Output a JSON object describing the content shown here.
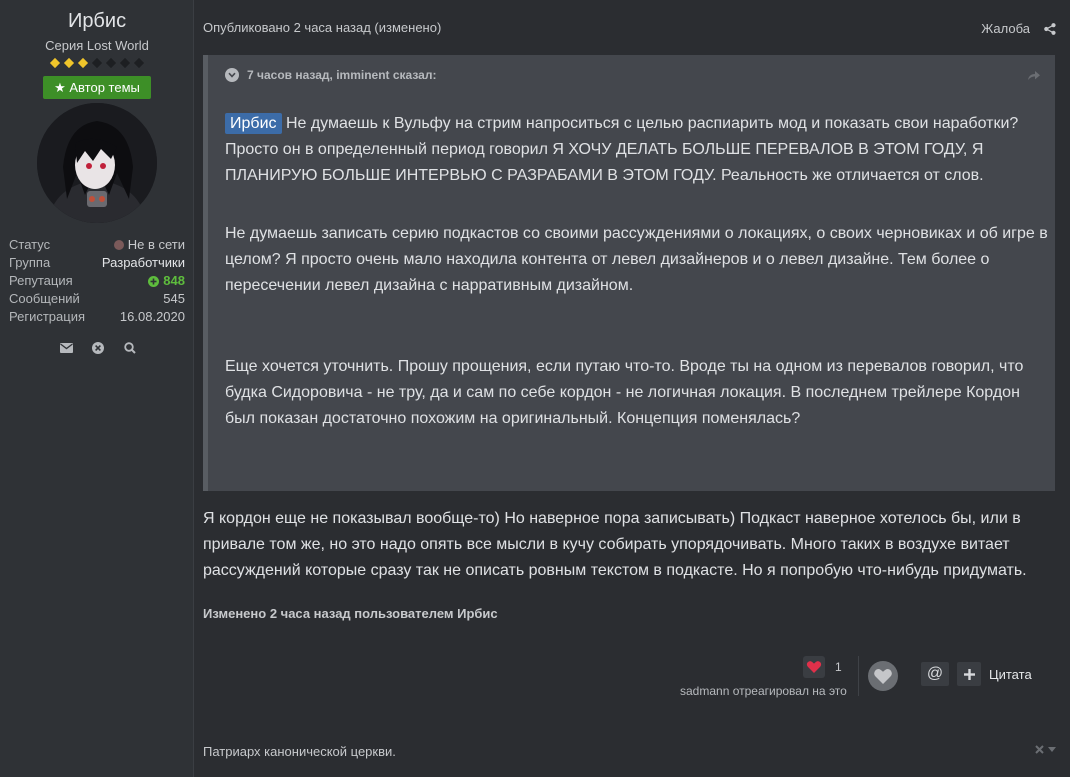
{
  "author": {
    "name": "Ирбис",
    "title": "Серия Lost World",
    "rank_pips": [
      true,
      true,
      true,
      false,
      false,
      false,
      false
    ],
    "badge_label": "Автор темы",
    "stats": [
      {
        "key": "Статус",
        "value": "Не в сети"
      },
      {
        "key": "Группа",
        "value": "Разработчики"
      },
      {
        "key": "Репутация",
        "value": "848"
      },
      {
        "key": "Сообщений",
        "value": "545"
      },
      {
        "key": "Регистрация",
        "value": "16.08.2020"
      }
    ],
    "actions": [
      "envelope-icon",
      "close-circle-icon",
      "search-icon"
    ]
  },
  "post": {
    "meta": "Опубликовано 2 часа назад (изменено)",
    "report_label": "Жалоба",
    "quote": {
      "header": "7 часов назад, imminent сказал:",
      "mention": "Ирбис",
      "p1": " Не думаешь к Вульфу на стрим напроситься с целью распиарить мод и показать свои наработки? Просто он в определенный период говорил Я ХОЧУ ДЕЛАТЬ БОЛЬШЕ ПЕРЕВАЛОВ В ЭТОМ ГОДУ, Я ПЛАНИРУЮ БОЛЬШЕ ИНТЕРВЬЮ С РАЗРАБАМИ В ЭТОМ ГОДУ. Реальность же отличается от слов.",
      "p2": "Не думаешь записать серию подкастов со своими рассуждениями о локациях, о своих черновиках и об игре в целом? Я просто очень мало находила контента от левел дизайнеров и о левел дизайне. Тем более о пересечении левел дизайна с нарративным дизайном.",
      "p3": "Еще хочется уточнить. Прошу прощения, если путаю что-то. Вроде ты на одном из перевалов говорил, что будка Сидоровича - не тру, да и сам по себе кордон - не логичная локация. В последнем трейлере Кордон был показан достаточно похожим на оригинальный. Концепция поменялась?"
    },
    "reply": "Я кордон еще не показывал вообще-то) Но наверное пора записывать) Подкаст наверное хотелось бы, или в привале том же, но это надо опять все мысли в кучу собирать упорядочивать. Много таких в воздухе витает рассуждений которые сразу так не описать ровным текстом в подкасте. Но я попробую что-нибудь придумать.",
    "edited": "Изменено 2 часа назад пользователем Ирбис",
    "reaction_count": "1",
    "reacted_by": "sadmann отреагировал на это",
    "mention_button": "@",
    "quote_button": "Цитата",
    "signature": "Патриарх канонической церкви."
  },
  "colors": {
    "background": "#2b2d31",
    "sidebar": "#2f3236",
    "quote_bg": "#44474d",
    "badge_green": "#3d8f27",
    "mention_blue": "#3c6ca8",
    "rep_green": "#5ebd3d",
    "pip_gold": "#f0c52b"
  }
}
